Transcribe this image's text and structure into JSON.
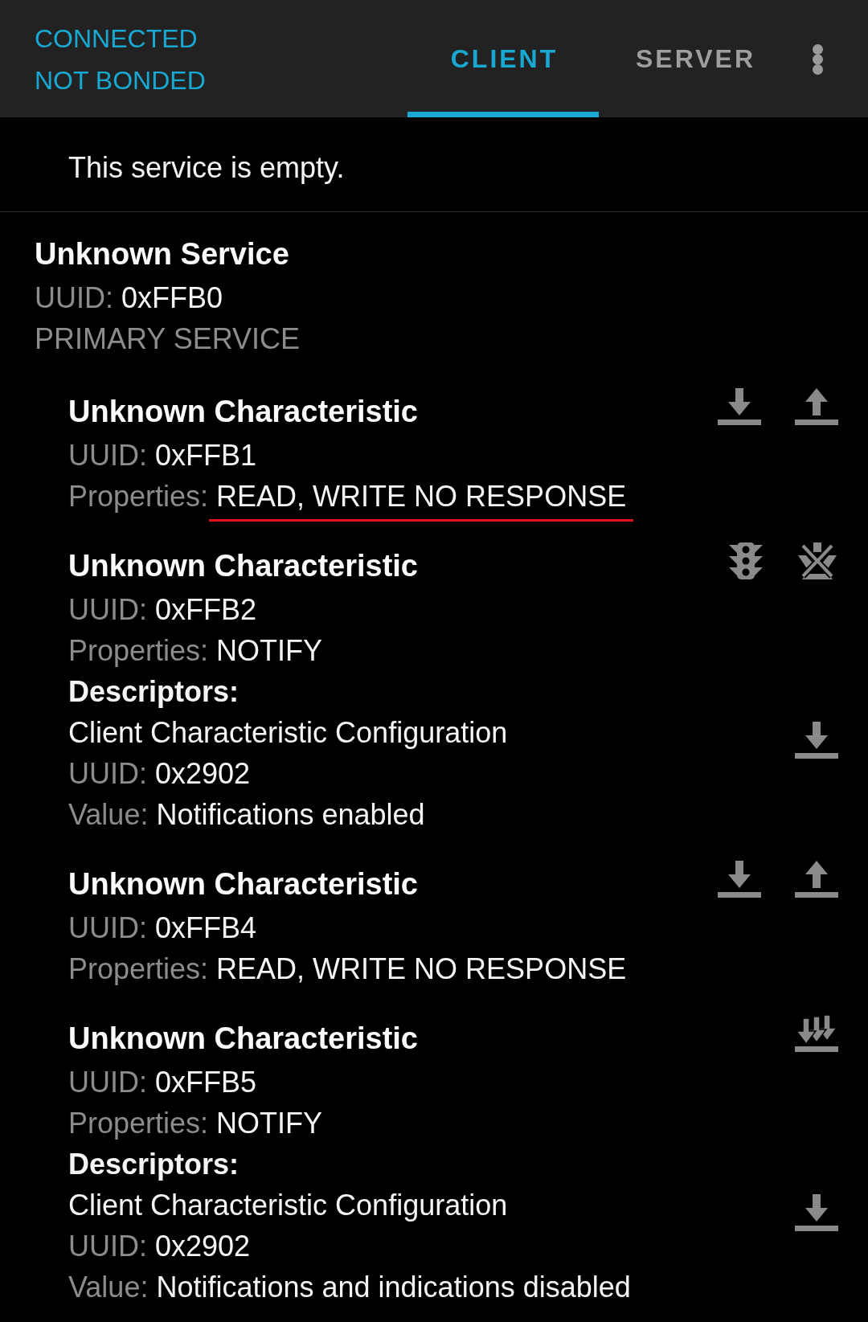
{
  "app_bar": {
    "connection_status": "CONNECTED",
    "bond_status": "NOT BONDED"
  },
  "tabs": [
    {
      "label": "CLIENT",
      "selected": true
    },
    {
      "label": "SERVER",
      "selected": false
    }
  ],
  "services": [
    {
      "kind": "empty",
      "message": "This service is empty."
    },
    {
      "kind": "service",
      "name": "Unknown Service",
      "uuid_label": "UUID:",
      "uuid": "0xFFB0",
      "type": "PRIMARY SERVICE",
      "characteristics": [
        {
          "name": "Unknown Characteristic",
          "uuid_label": "UUID:",
          "uuid": "0xFFB1",
          "properties_label": "Properties:",
          "properties": "READ, WRITE NO RESPONSE",
          "marked": true,
          "actions": [
            {
              "kind": "read"
            },
            {
              "kind": "write"
            }
          ]
        },
        {
          "name": "Unknown Characteristic",
          "uuid_label": "UUID:",
          "uuid": "0xFFB2",
          "properties_label": "Properties:",
          "properties": "NOTIFY",
          "marked": false,
          "actions": [
            {
              "kind": "lights"
            },
            {
              "kind": "mute"
            }
          ],
          "descriptors_label": "Descriptors:",
          "descriptors": [
            {
              "name": "Client Characteristic Configuration",
              "uuid_label": "UUID:",
              "uuid": "0x2902",
              "value_label": "Value:",
              "value": "Notifications enabled",
              "actions": [
                {
                  "kind": "read"
                }
              ]
            }
          ]
        },
        {
          "name": "Unknown Characteristic",
          "uuid_label": "UUID:",
          "uuid": "0xFFB4",
          "properties_label": "Properties:",
          "properties": "READ, WRITE NO RESPONSE",
          "marked": false,
          "actions": [
            {
              "kind": "read"
            },
            {
              "kind": "write"
            }
          ]
        },
        {
          "name": "Unknown Characteristic",
          "uuid_label": "UUID:",
          "uuid": "0xFFB5",
          "properties_label": "Properties:",
          "properties": "NOTIFY",
          "marked": false,
          "actions": [
            {
              "kind": "notify"
            }
          ],
          "descriptors_label": "Descriptors:",
          "descriptors": [
            {
              "name": "Client Characteristic Configuration",
              "uuid_label": "UUID:",
              "uuid": "0x2902",
              "value_label": "Value:",
              "value": "Notifications and indications disabled",
              "actions": [
                {
                  "kind": "read"
                }
              ]
            }
          ]
        }
      ]
    }
  ]
}
